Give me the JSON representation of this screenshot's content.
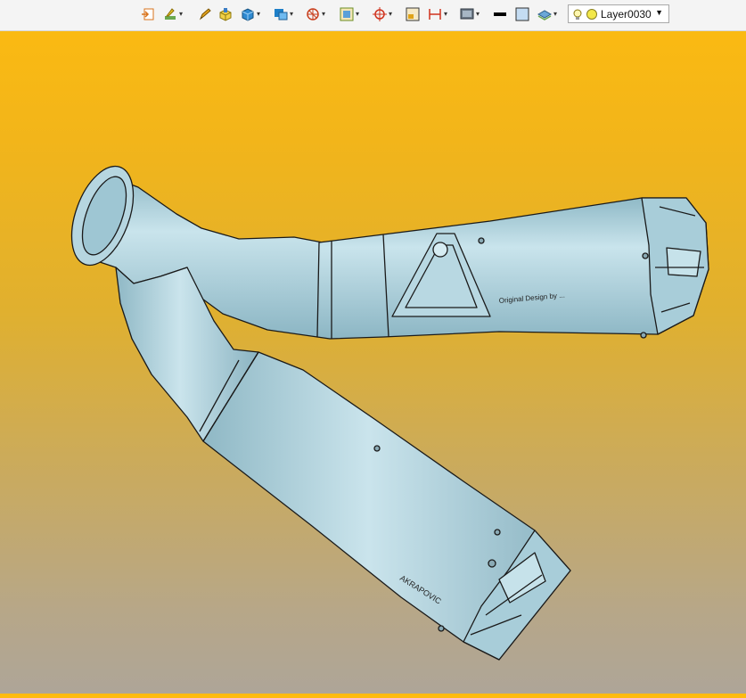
{
  "toolbar": {
    "layer": {
      "name": "Layer0030"
    },
    "items": [
      {
        "icon": "exit-sketch-icon",
        "dropdown": false
      },
      {
        "icon": "sketch-tools-icon",
        "dropdown": true
      },
      {
        "icon": "pencil-icon",
        "dropdown": false
      },
      {
        "icon": "extrude-icon",
        "dropdown": false
      },
      {
        "icon": "solid-box-icon",
        "dropdown": true
      },
      {
        "icon": "view-orientation-icon",
        "dropdown": true
      },
      {
        "icon": "section-view-icon",
        "dropdown": true
      },
      {
        "icon": "zoom-fit-icon",
        "dropdown": true
      },
      {
        "icon": "target-icon",
        "dropdown": true
      },
      {
        "icon": "frame-icon",
        "dropdown": false
      },
      {
        "icon": "dimension-icon",
        "dropdown": true
      },
      {
        "icon": "display-style-icon",
        "dropdown": true
      },
      {
        "icon": "line-color-icon",
        "dropdown": false
      },
      {
        "icon": "fill-color-icon",
        "dropdown": false
      },
      {
        "icon": "layer-stack-icon",
        "dropdown": true
      }
    ]
  },
  "model": {
    "upper_label": "Original Design by ...",
    "lower_label": "AKRAPOVIC"
  },
  "colors": {
    "background_top": "#fdbb10",
    "background_bottom": "#aea598",
    "part_fill": "#a9cfdb",
    "edge": "#1a1a1a"
  }
}
